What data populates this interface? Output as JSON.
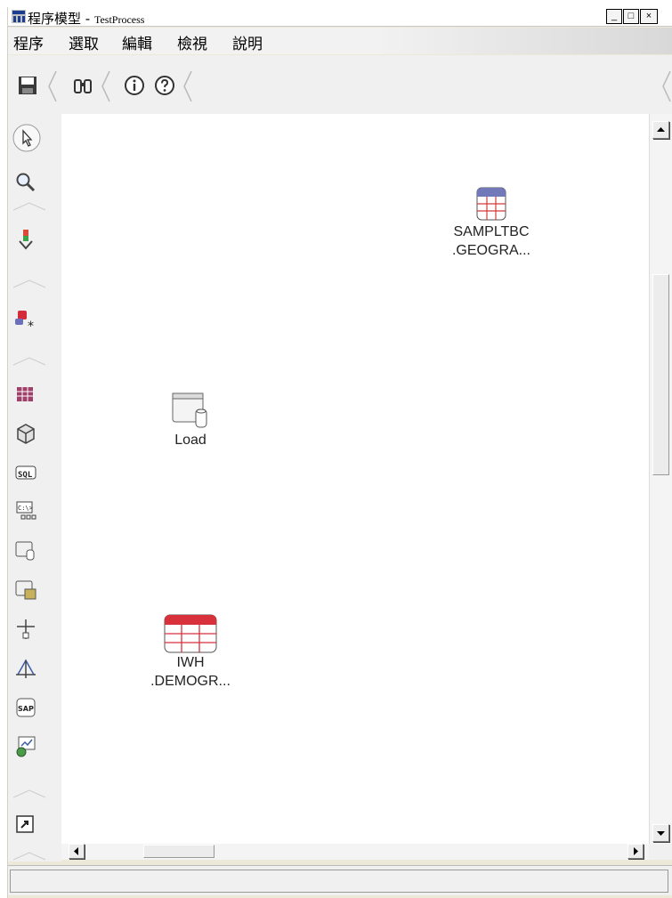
{
  "window": {
    "title": "程序模型 - ",
    "title_sub": "TestProcess",
    "buttons": {
      "minimize": "_",
      "maximize": "□",
      "close": "×"
    }
  },
  "menubar": {
    "items": [
      "程序",
      "選取",
      "編輯",
      "檢視",
      "說明"
    ]
  },
  "toolbar": {
    "icons": [
      "save-icon",
      "binoculars-icon",
      "info-icon",
      "help-icon"
    ]
  },
  "palette": {
    "icons": [
      "select-pointer-icon",
      "zoom-icon",
      "flow-arrow-icon",
      "data-object-icon",
      "table-grid-icon",
      "cube-icon",
      "sql-icon",
      "command-icon",
      "load-file-icon",
      "file-table-icon",
      "tree-split-icon",
      "triangle-flow-icon",
      "sap-icon",
      "web-service-icon",
      "shortcut-icon"
    ]
  },
  "canvas": {
    "nodes": [
      {
        "line1": "SAMPLTBC",
        "line2": ".GEOGRA...",
        "kind": "source-table",
        "color": "#7279b8"
      },
      {
        "line1": "Load",
        "line2": "",
        "kind": "load-step",
        "color": "#9a9a9a"
      },
      {
        "line1": "IWH",
        "line2": ".DEMOGR...",
        "kind": "target-table",
        "color": "#d9313c"
      }
    ]
  },
  "statusbar": {
    "text": ""
  },
  "colors": {
    "chrome": "#f0f0f0",
    "canvas": "#ffffff",
    "source_table": "#7279b8",
    "target_table": "#d9313c"
  }
}
